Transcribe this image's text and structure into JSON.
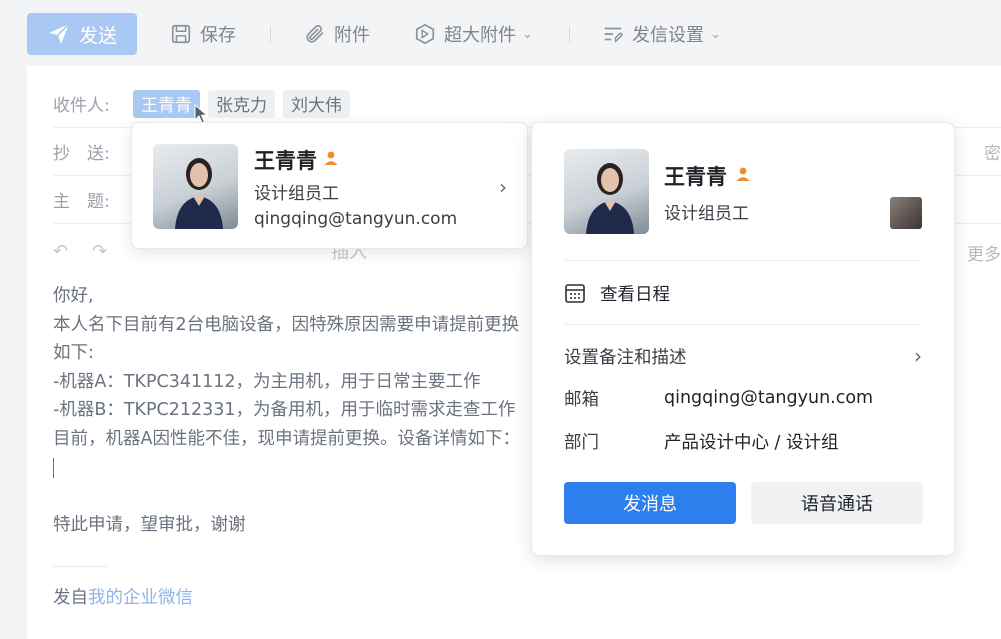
{
  "toolbar": {
    "send_label": "发送",
    "save_label": "保存",
    "attach_label": "附件",
    "large_attach_label": "超大附件",
    "send_settings_label": "发信设置"
  },
  "fields": {
    "to_label": "收件人:",
    "cc_label": "抄　送:",
    "subject_label": "主　题:",
    "bcc_label": "密",
    "recipients": [
      "王青青",
      "张克力",
      "刘大伟"
    ]
  },
  "editor": {
    "insert_label": "插入",
    "more_label": "更多"
  },
  "body": {
    "lines": [
      "你好,",
      "本人名下目前有2台电脑设备，因特殊原因需要申请提前更换",
      "如下:",
      "-机器A：TKPC341112，为主用机，用于日常主要工作",
      "-机器B：TKPC212331，为备用机，用于临时需求走查工作",
      "目前，机器A因性能不佳，现申请提前更换。设备详情如下："
    ],
    "closing": "特此申请，望审批，谢谢",
    "signature_prefix": "发自",
    "signature_link": "我的企业微信"
  },
  "hover_card": {
    "name": "王青青",
    "title": "设计组员工",
    "email": "qingqing@tangyun.com"
  },
  "profile": {
    "name": "王青青",
    "title": "设计组员工",
    "view_schedule": "查看日程",
    "set_remark": "设置备注和描述",
    "email_label": "邮箱",
    "email_value": "qingqing@tangyun.com",
    "dept_label": "部门",
    "dept_value": "产品设计中心 / 设计组",
    "message_button": "发消息",
    "voice_button": "语音通话"
  },
  "colors": {
    "primary": "#2d7fed",
    "send_disabled": "#a9c8f3",
    "person_icon": "#f08b2e"
  }
}
